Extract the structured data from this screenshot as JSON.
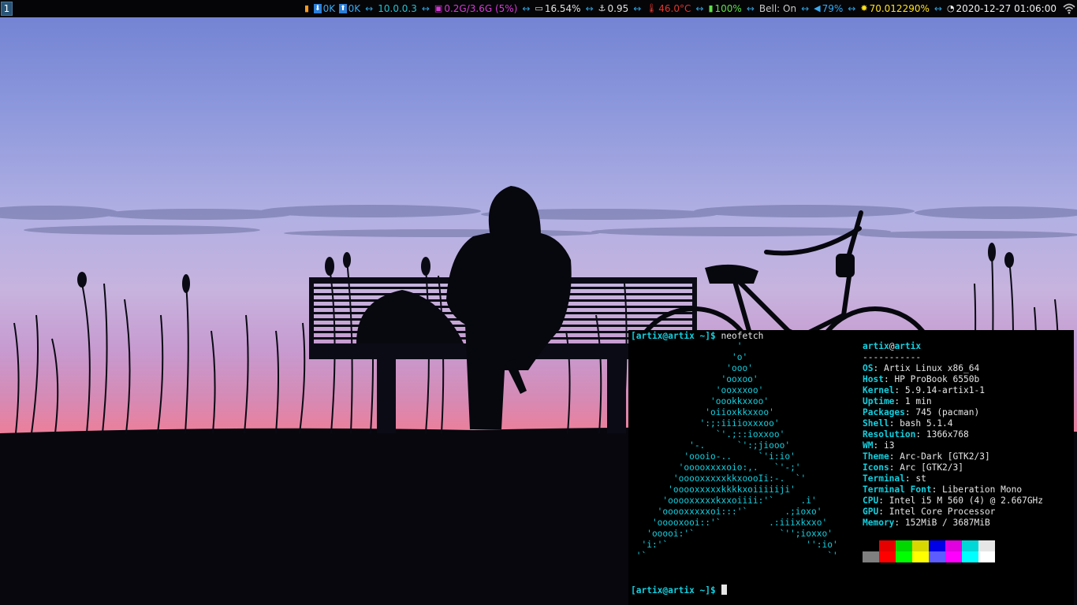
{
  "workspace": {
    "number": "1"
  },
  "status_bar": {
    "items": [
      {
        "name": "network-activity",
        "icon": "signal-bars-icon",
        "text": "",
        "color": "#ff9a1f"
      },
      {
        "name": "download",
        "icon": "download-arrow-icon",
        "text": "0K",
        "color": "#3aa9f0"
      },
      {
        "name": "upload",
        "icon": "upload-arrow-icon",
        "text": "0K",
        "color": "#3aa9f0"
      },
      {
        "name": "ip-address",
        "icon": "",
        "text": "10.0.0.3",
        "color": "#1ec3d2"
      },
      {
        "name": "disk",
        "icon": "floppy-disk-icon",
        "text": "0.2G/3.6G (5%)",
        "color": "#d63bd6"
      },
      {
        "name": "cpu",
        "icon": "laptop-icon",
        "text": "16.54%",
        "color": "#e0e0e0"
      },
      {
        "name": "load",
        "icon": "anchor-icon",
        "text": "0.95",
        "color": "#e0e0e0"
      },
      {
        "name": "temperature",
        "icon": "thermometer-icon",
        "text": "46.0°C",
        "color": "#e0352d"
      },
      {
        "name": "battery",
        "icon": "battery-icon",
        "text": "100%",
        "color": "#5ee04a"
      },
      {
        "name": "bell",
        "icon": "",
        "text": "Bell: On",
        "color": "#c8c8c8"
      },
      {
        "name": "volume",
        "icon": "speaker-icon",
        "text": "79%",
        "color": "#3aa9f0"
      },
      {
        "name": "brightness",
        "icon": "sun-icon",
        "text": "70.012290%",
        "color": "#ffe11d"
      },
      {
        "name": "clock",
        "icon": "clock-icon",
        "text": "2020-12-27 01:06:00",
        "color": "#f2f2f2"
      }
    ],
    "separator": "↔",
    "wifi_icon": "wifi-icon"
  },
  "terminal": {
    "prompt_user": "[artix@artix ~]$",
    "command": " neofetch",
    "logo_lines": [
      "                    '",
      "                   'o'",
      "                  'ooo'",
      "                 'ooxoo'",
      "                'ooxxxoo'",
      "               'oookkxxoo'",
      "              'oiioxkkxxoo'",
      "             ':;:iiiioxxxoo'",
      "                `'.;::ioxxoo'",
      "           '-.      `':;jiooo'",
      "          'oooio-..     `'i:io'",
      "         'ooooxxxxoio:,.   `'-;'",
      "        'ooooxxxxxkkxoooIi:-.  `'",
      "       'ooooxxxxxkkkkxoiiiiiji'",
      "      'ooooxxxxxkxxoiiii:'`     .i'",
      "     'ooooxxxxxoi:::'`       .;ioxo'",
      "    'ooooxooi::'`         .:iiixkxxo'",
      "   'ooooi:'`                `'';ioxxo'",
      "  'i:'`                          '':io'",
      " '`                                  `'"
    ],
    "info": {
      "user": "artix",
      "at": "@",
      "host": "artix",
      "divider": "-----------",
      "rows": [
        {
          "key": "OS",
          "value": "Artix Linux x86_64"
        },
        {
          "key": "Host",
          "value": "HP ProBook 6550b"
        },
        {
          "key": "Kernel",
          "value": "5.9.14-artix1-1"
        },
        {
          "key": "Uptime",
          "value": "1 min"
        },
        {
          "key": "Packages",
          "value": "745 (pacman)"
        },
        {
          "key": "Shell",
          "value": "bash 5.1.4"
        },
        {
          "key": "Resolution",
          "value": "1366x768"
        },
        {
          "key": "WM",
          "value": "i3"
        },
        {
          "key": "Theme",
          "value": "Arc-Dark [GTK2/3]"
        },
        {
          "key": "Icons",
          "value": "Arc [GTK2/3]"
        },
        {
          "key": "Terminal",
          "value": "st"
        },
        {
          "key": "Terminal Font",
          "value": "Liberation Mono"
        },
        {
          "key": "CPU",
          "value": "Intel i5 M 560 (4) @ 2.667GHz"
        },
        {
          "key": "GPU",
          "value": "Intel Core Processor"
        },
        {
          "key": "Memory",
          "value": "152MiB / 3687MiB"
        }
      ]
    },
    "palette_top": [
      "#000000",
      "#e60000",
      "#00d800",
      "#d8d800",
      "#0000e6",
      "#e000e0",
      "#00d8d8",
      "#e6e6e6"
    ],
    "palette_bottom": [
      "#7f7f7f",
      "#ff0000",
      "#00ff00",
      "#ffff00",
      "#5c5cff",
      "#ff00ff",
      "#00ffff",
      "#ffffff"
    ]
  }
}
